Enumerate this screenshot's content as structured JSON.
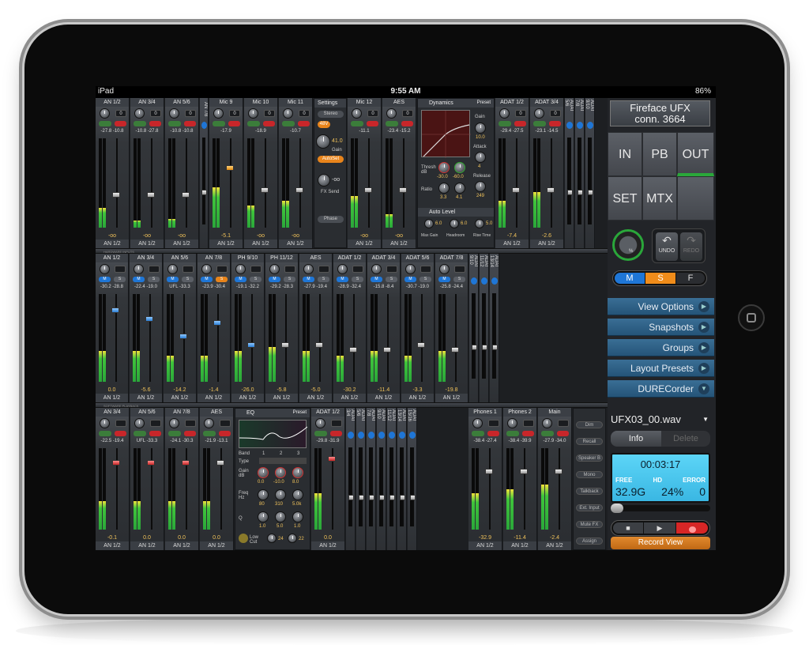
{
  "statusbar": {
    "device": "iPad",
    "time": "9:55 AM",
    "battery": "86%"
  },
  "hw": {
    "strips": [
      {
        "name": "AN 1/2",
        "gain": "0",
        "lvl": "-27.8 -10.8",
        "val": "-oo",
        "bottom": "AN 1/2"
      },
      {
        "name": "AN 3/4",
        "gain": "0",
        "lvl": "-10.8 -27.8",
        "val": "-oo",
        "bottom": "AN 1/2"
      },
      {
        "name": "AN 5/6",
        "gain": "0",
        "lvl": "-10.8 -10.8",
        "val": "-oo",
        "bottom": "AN 1/2"
      },
      {
        "name": "AN 7/8",
        "gain": "",
        "lvl": "",
        "val": "",
        "bottom": ""
      },
      {
        "name": "Mic 9",
        "gain": "0",
        "lvl": "-17.9",
        "val": "-5.1",
        "bottom": "AN 1/2"
      },
      {
        "name": "Mic 10",
        "gain": "0",
        "lvl": "-18.9",
        "val": "-oo",
        "bottom": "AN 1/2"
      },
      {
        "name": "Mic 11",
        "gain": "0",
        "lvl": "-10.7",
        "val": "-oo",
        "bottom": "AN 1/2"
      }
    ],
    "strips2": [
      {
        "name": "Mic 12",
        "gain": "0",
        "lvl": "-11.1",
        "val": "-oo",
        "bottom": "AN 1/2"
      },
      {
        "name": "AES",
        "gain": "0",
        "lvl": "-23.4 -15.2",
        "val": "-oo",
        "bottom": "AN 1/2"
      }
    ],
    "strips3": [
      {
        "name": "ADAT 1/2",
        "gain": "0",
        "lvl": "-29.4 -27.5",
        "val": "-7.4",
        "bottom": "AN 1/2"
      },
      {
        "name": "ADAT 3/4",
        "gain": "0",
        "lvl": "-23.1 -14.5",
        "val": "-2.6",
        "bottom": "AN 1/2"
      }
    ],
    "vstrips": [
      "ADAT 5/6",
      "ADAT 7/8",
      "ADAT 9/10"
    ],
    "settings": {
      "title": "Settings",
      "stereo": "Stereo",
      "inv": "48V",
      "fx": "FX Send",
      "gain_val": "41.0",
      "gain_lbl": "Gain",
      "autoset": "AutoSet",
      "phase": "Phase",
      "fxsend_val": "-oo"
    },
    "dynamics": {
      "title": "Dynamics",
      "preset": "Preset",
      "gain": "Gain",
      "gain_val": "10.0",
      "attack": "Attack",
      "attack_val": "4",
      "release": "Release",
      "release_val": "249",
      "thresh": "Thresh dB",
      "thresh1": "-30.0",
      "thresh2": "-60.0",
      "ratio": "Ratio",
      "ratio1": "3.3",
      "ratio2": "4.1",
      "autolevel": "Auto Level",
      "max_gain": "Max Gain",
      "headroom": "Headroom",
      "rise_time": "Rise Time",
      "al1": "6.0",
      "al2": "6.0",
      "al3": "5.0"
    },
    "section_label": "HARDWARE INPUTS"
  },
  "sw": {
    "section_label": "SOFTWARE PLAYBACK",
    "strips": [
      {
        "name": "AN 1/2",
        "lvl": "-30.2 -28.8",
        "val": "0.0",
        "bottom": "AN 1/2"
      },
      {
        "name": "AN 3/4",
        "lvl": "-22.4 -19.0",
        "val": "-5.6",
        "bottom": "AN 1/2"
      },
      {
        "name": "AN 5/6",
        "lvl": "UFL -33.3",
        "val": "-14.2",
        "bottom": "AN 1/2"
      },
      {
        "name": "AN 7/8",
        "lvl": "-23.9 -30.4",
        "val": "-1.4",
        "bottom": "AN 1/2"
      },
      {
        "name": "PH 9/10",
        "lvl": "-19.1 -32.2",
        "val": "-26.0",
        "bottom": "AN 1/2"
      },
      {
        "name": "PH 11/12",
        "lvl": "-29.2 -28.3",
        "val": "-5.8",
        "bottom": "AN 1/2"
      },
      {
        "name": "AES",
        "lvl": "-27.9 -19.4",
        "val": "-5.0",
        "bottom": "AN 1/2"
      },
      {
        "name": "ADAT 1/2",
        "lvl": "-28.9 -32.4",
        "val": "-30.2",
        "bottom": "AN 1/2"
      },
      {
        "name": "ADAT 3/4",
        "lvl": "-15.8 -8.4",
        "val": "-11.4",
        "bottom": "AN 1/2"
      },
      {
        "name": "ADAT 5/6",
        "lvl": "-30.7 -19.0",
        "val": "-3.3",
        "bottom": "AN 1/2"
      },
      {
        "name": "ADAT 7/8",
        "lvl": "-25.8 -24.4",
        "val": "-19.8",
        "bottom": "AN 1/2"
      }
    ],
    "vstrips": [
      "ADAT 9/10",
      "ADAT 11/12",
      "ADAT 13/14"
    ],
    "m": "M",
    "s": "S"
  },
  "out": {
    "strips": [
      {
        "name": "AN 3/4",
        "lvl": "-22.5 -19.4",
        "val": "-0.1",
        "bottom": "AN 1/2"
      },
      {
        "name": "AN 5/6",
        "lvl": "UFL -33.3",
        "val": "0.0",
        "bottom": "AN 1/2"
      },
      {
        "name": "AN 7/8",
        "lvl": "-24.1 -30.3",
        "val": "0.0",
        "bottom": "AN 1/2"
      },
      {
        "name": "AES",
        "lvl": "-21.9 -13.1",
        "val": "0.0",
        "bottom": "AN 1/2"
      }
    ],
    "adat": {
      "name": "ADAT 1/2",
      "lvl": "-29.8 -31.9",
      "val": "0.0",
      "bottom": "AN 1/2"
    },
    "vstrips": [
      "ADAT 3/4",
      "ADAT 5/6",
      "ADAT 7/8",
      "ADAT 9/10",
      "ADAT 11/12",
      "ADAT 13/14",
      "ADAT 15/16"
    ],
    "phones": [
      {
        "name": "Phones 1",
        "lvl": "-38.4 -27.4",
        "val": "-32.9",
        "bottom": "AN 1/2"
      },
      {
        "name": "Phones 2",
        "lvl": "-38.4 -39.9",
        "val": "-11.4",
        "bottom": "AN 1/2"
      },
      {
        "name": "Main",
        "lvl": "-27.9 -34.0",
        "val": "-2.4",
        "bottom": "AN 1/2"
      }
    ],
    "side": [
      "Dim",
      "Recall",
      "Speaker B",
      "Mono",
      "Talkback",
      "Ext. Input",
      "Mute FX",
      "Assign"
    ],
    "eq": {
      "title": "EQ",
      "preset": "Preset",
      "band": "Band",
      "type": "Type",
      "gain": "Gain dB",
      "freq": "Freq Hz",
      "q": "Q",
      "lowcut": "Low Cut",
      "b1": "1",
      "b2": "2",
      "b3": "3",
      "g1": "0.0",
      "g2": "-10.0",
      "g3": "8.0",
      "f1": "80",
      "f2": "310",
      "f3": "5.0k",
      "q1": "1.0",
      "q2": "5.0",
      "q3": "1.0",
      "lc1": "24",
      "lc2": "22"
    }
  },
  "right": {
    "device": "Fireface  UFX",
    "conn": "conn. 3664",
    "in": "IN",
    "pb": "PB",
    "out": "OUT",
    "set": "SET",
    "mtx": "MTX",
    "pct": "%",
    "undo": "UNDO",
    "redo": "REDO",
    "m": "M",
    "s": "S",
    "f": "F",
    "menus": [
      "View Options",
      "Snapshots",
      "Groups",
      "Layout Presets",
      "DURECorder"
    ],
    "file": "UFX03_00.wav",
    "info": "Info",
    "delete": "Delete",
    "rec_time": "00:03:17",
    "free_lbl": "FREE",
    "hd_lbl": "HD",
    "err_lbl": "ERROR",
    "free": "32.9G",
    "hd": "24%",
    "err": "0",
    "record_view": "Record View"
  }
}
